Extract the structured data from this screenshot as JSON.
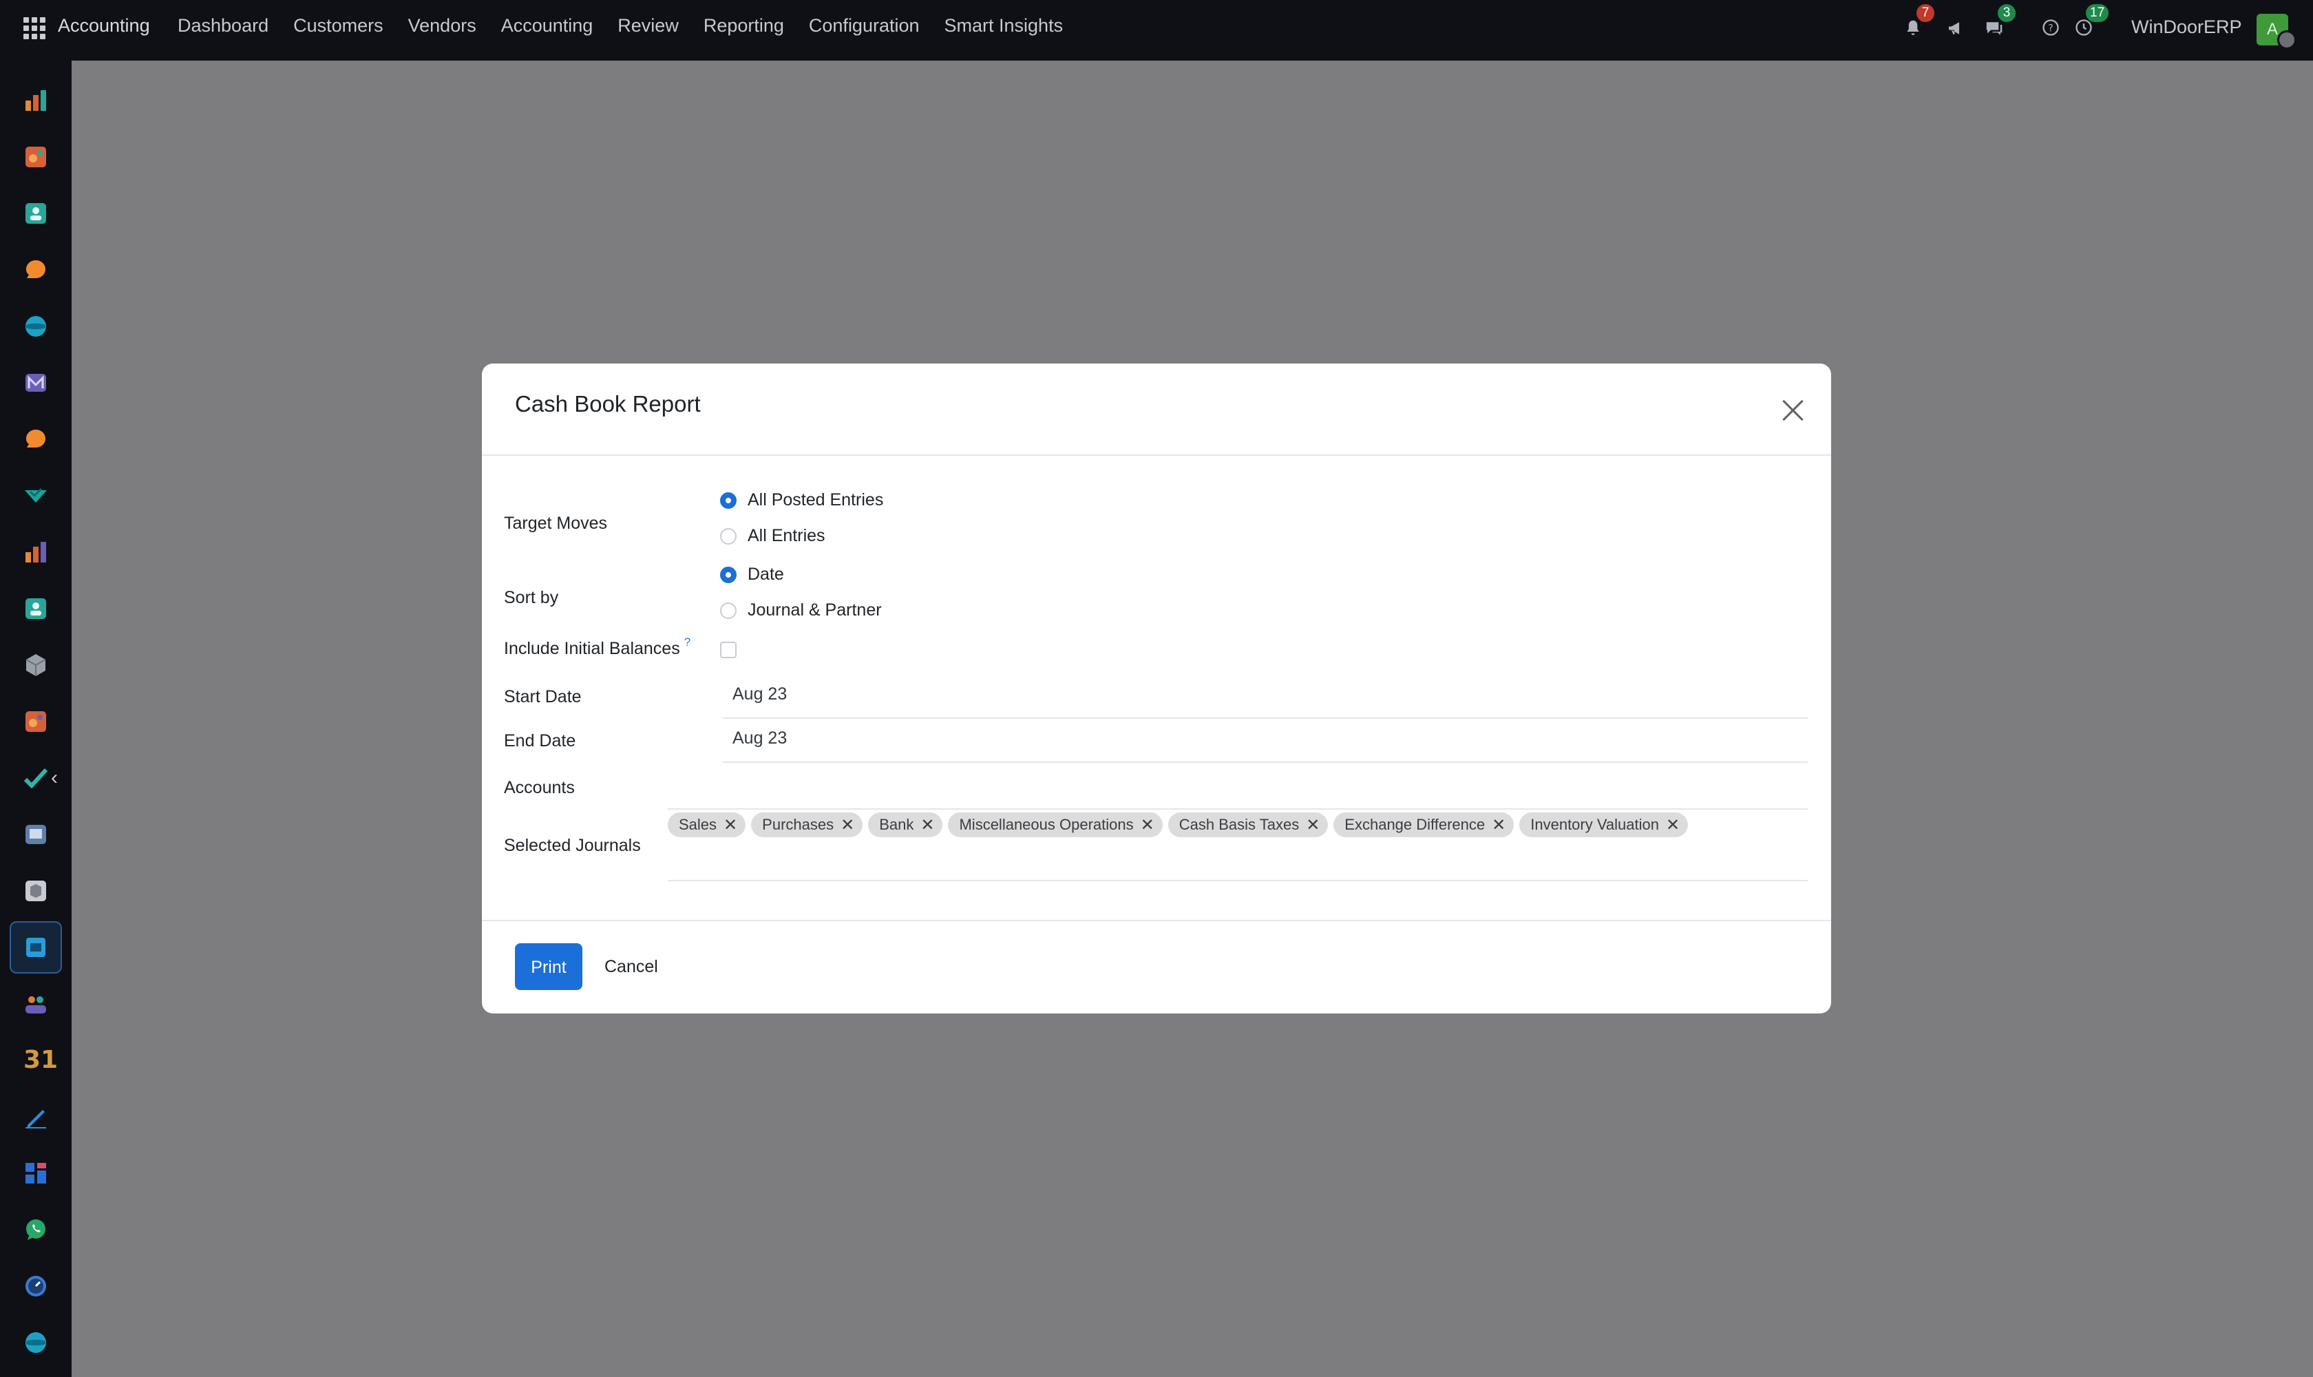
{
  "navbar": {
    "brand": "Accounting",
    "menu": [
      "Dashboard",
      "Customers",
      "Vendors",
      "Accounting",
      "Review",
      "Reporting",
      "Configuration",
      "Smart Insights"
    ],
    "notifications_count": "7",
    "messages_count": "3",
    "activities_count": "17",
    "company": "WinDoorERP",
    "avatar_initial": "A"
  },
  "sidebar": {
    "apps": [
      {
        "icon": "sales-chart-icon",
        "color": "#e08a3c"
      },
      {
        "icon": "puzzle-icon",
        "color": "#d6603a"
      },
      {
        "icon": "contacts-icon",
        "color": "#2aa59a"
      },
      {
        "icon": "chat-bubble-icon",
        "color": "#f28b30"
      },
      {
        "icon": "globe-icon",
        "color": "#1aa3c4"
      },
      {
        "icon": "mail-icon",
        "color": "#6a5fb5"
      },
      {
        "icon": "discuss-icon",
        "color": "#f28b30"
      },
      {
        "icon": "check-flag-icon",
        "color": "#19a59a"
      },
      {
        "icon": "bar-chart-icon",
        "color": "#e07a3c"
      },
      {
        "icon": "employee-card-icon",
        "color": "#2aa59a"
      },
      {
        "icon": "cube-icon",
        "color": "#9aa0a8"
      },
      {
        "icon": "inventory-icon",
        "color": "#d6603a"
      },
      {
        "icon": "checkmark-icon",
        "color": "#2fb5a8"
      },
      {
        "icon": "book-icon",
        "color": "#5e7fa8"
      },
      {
        "icon": "box-icon",
        "color": "#c8cbd2"
      },
      {
        "icon": "accounting-icon",
        "color": "#2a9dd6"
      },
      {
        "icon": "people-icon",
        "color": "#e07a3c"
      },
      {
        "icon": "calendar-icon",
        "color": "#d49a3a",
        "label": "31"
      },
      {
        "icon": "sign-pen-icon",
        "color": "#2a8fd6"
      },
      {
        "icon": "dashboard-icon",
        "color": "#2a6fd6"
      },
      {
        "icon": "whatsapp-icon",
        "color": "#25a868"
      },
      {
        "icon": "timer-icon",
        "color": "#3a7ad6"
      },
      {
        "icon": "web-icon",
        "color": "#1aa3c4"
      }
    ]
  },
  "dialog": {
    "title": "Cash Book Report",
    "target_moves_label": "Target Moves",
    "target_moves_options": [
      "All Posted Entries",
      "All Entries"
    ],
    "target_moves_selected": "All Posted Entries",
    "sort_by_label": "Sort by",
    "sort_by_options": [
      "Date",
      "Journal & Partner"
    ],
    "sort_by_selected": "Date",
    "initial_balances_label": "Include Initial Balances",
    "initial_balances_help": "?",
    "initial_balances_checked": false,
    "start_date_label": "Start Date",
    "start_date_value": "Aug 23",
    "end_date_label": "End Date",
    "end_date_value": "Aug 23",
    "accounts_label": "Accounts",
    "journals_label": "Selected Journals",
    "journals": [
      "Sales",
      "Purchases",
      "Bank",
      "Miscellaneous Operations",
      "Cash Basis Taxes",
      "Exchange Difference",
      "Inventory Valuation"
    ],
    "tag_remove_glyph": "✕",
    "print_label": "Print",
    "cancel_label": "Cancel"
  }
}
